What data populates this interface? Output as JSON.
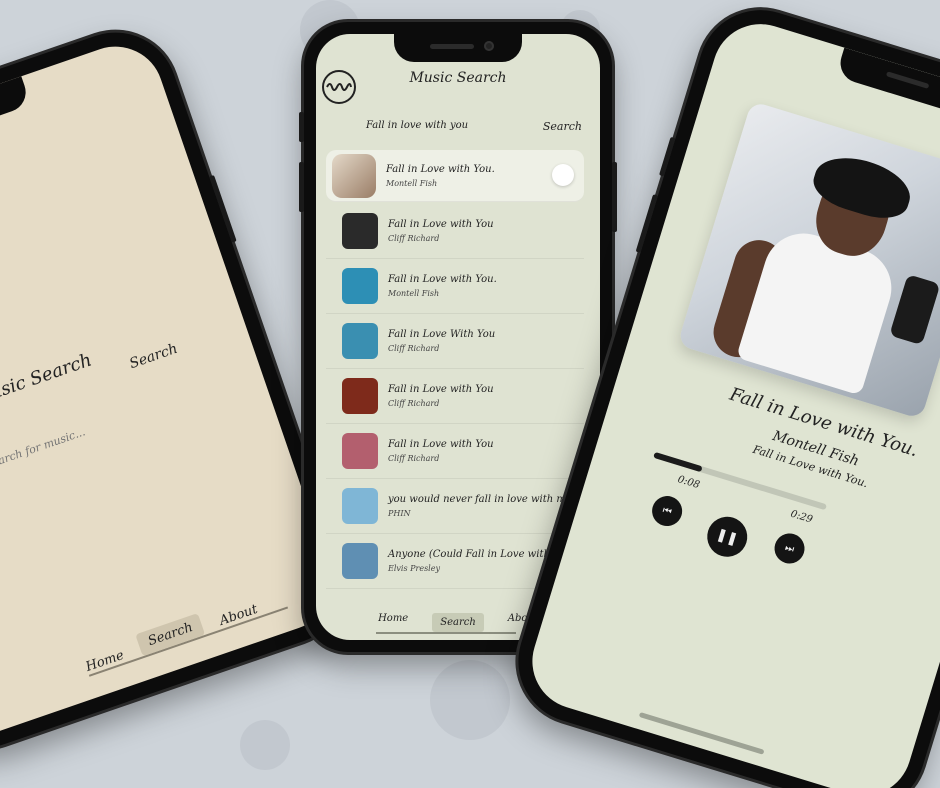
{
  "colors": {
    "background": "#cdd3d9",
    "phone1_screen": "#e6dcc6",
    "phone2_screen": "#dfe3d2",
    "phone3_screen": "#dfe4d2"
  },
  "phone1": {
    "title": "Music Search",
    "search_label": "Search",
    "search_placeholder": "Search for music...",
    "nav": {
      "home": "Home",
      "search": "Search",
      "about": "About"
    }
  },
  "phone2": {
    "logo_icon": "waveform-icon",
    "title": "Music Search",
    "query": "Fall in love with you",
    "search_label": "Search",
    "results": [
      {
        "track": "Fall in Love with You.",
        "artist": "Montell Fish",
        "art_color": "#c7b7a6"
      },
      {
        "track": "Fall in Love with You",
        "artist": "Cliff Richard",
        "art_color": "#2a2a2a"
      },
      {
        "track": "Fall in Love with You.",
        "artist": "Montell Fish",
        "art_color": "#2d8fb5"
      },
      {
        "track": "Fall in Love With You",
        "artist": "Cliff Richard",
        "art_color": "#3a8fb1"
      },
      {
        "track": "Fall in Love with You",
        "artist": "Cliff Richard",
        "art_color": "#7e2a1b"
      },
      {
        "track": "Fall in Love with You",
        "artist": "Cliff Richard",
        "art_color": "#b35f6e"
      },
      {
        "track": "you would never fall in love with me",
        "artist": "PHIN",
        "art_color": "#7fb6d6"
      },
      {
        "track": "Anyone (Could Fall in Love with You)",
        "artist": "Elvis Presley",
        "art_color": "#5f8fb3"
      }
    ],
    "nav": {
      "home": "Home",
      "search": "Search",
      "about": "About"
    }
  },
  "phone3": {
    "track_title": "Fall in Love with You.",
    "artist": "Montell Fish",
    "album": "Fall in Love with You.",
    "elapsed": "0:08",
    "duration": "0:29",
    "progress_fraction": 0.28,
    "controls": {
      "prev_icon": "skip-previous-icon",
      "pause_icon": "pause-icon",
      "next_icon": "skip-next-icon"
    }
  }
}
